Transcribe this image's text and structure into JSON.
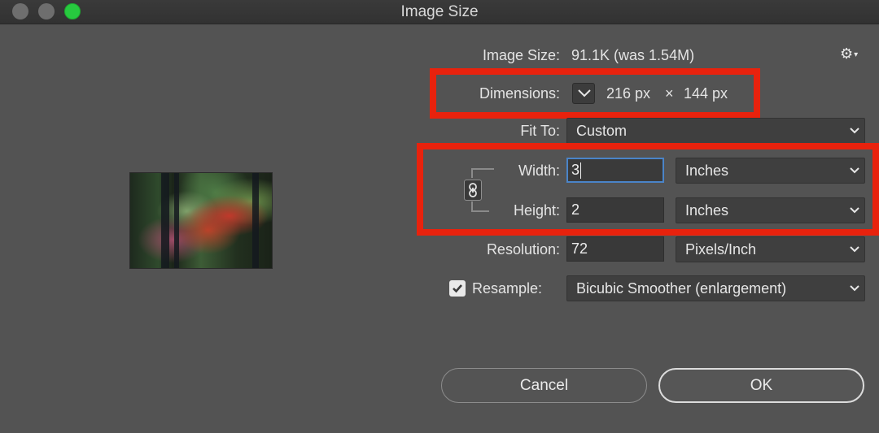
{
  "window": {
    "title": "Image Size"
  },
  "info": {
    "image_size_label": "Image Size:",
    "image_size_value": "91.1K (was 1.54M)",
    "dimensions_label": "Dimensions:",
    "width_px": "216 px",
    "times": "×",
    "height_px": "144 px"
  },
  "fit_to": {
    "label": "Fit To:",
    "value": "Custom"
  },
  "width": {
    "label": "Width:",
    "value": "3",
    "unit": "Inches"
  },
  "height": {
    "label": "Height:",
    "value": "2",
    "unit": "Inches"
  },
  "resolution": {
    "label": "Resolution:",
    "value": "72",
    "unit": "Pixels/Inch"
  },
  "resample": {
    "label": "Resample:",
    "checked": true,
    "value": "Bicubic Smoother (enlargement)"
  },
  "buttons": {
    "cancel": "Cancel",
    "ok": "OK"
  },
  "colors": {
    "highlight": "#e8220d",
    "focus": "#4a84c8",
    "zoom_button": "#27c93f"
  },
  "icons": {
    "settings": "gear-icon",
    "link": "chain-link-icon",
    "dimensions_menu": "chevron-down-icon",
    "resample": "checkbox-checked-icon"
  }
}
